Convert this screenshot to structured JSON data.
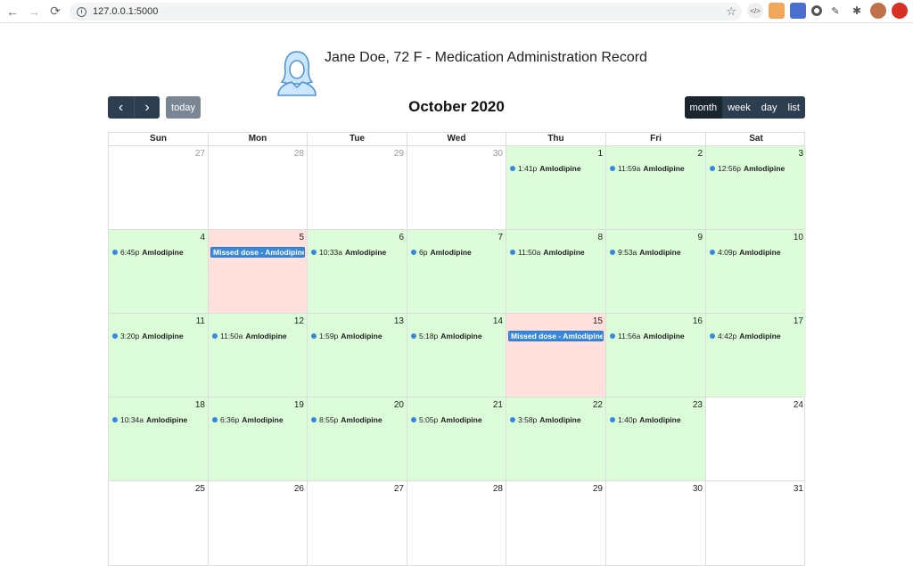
{
  "browser": {
    "url": "127.0.0.1:5000"
  },
  "header": {
    "title": "Jane Doe, 72 F - Medication Administration Record"
  },
  "toolbar": {
    "prev_label": "‹",
    "next_label": "›",
    "today_label": "today",
    "month_title": "October 2020",
    "views": [
      "month",
      "week",
      "day",
      "list"
    ],
    "active_view": "month"
  },
  "calendar": {
    "days_of_week": [
      "Sun",
      "Mon",
      "Tue",
      "Wed",
      "Thu",
      "Fri",
      "Sat"
    ],
    "medication": "Amlodipine",
    "missed_label": "Missed dose - Amlodipine",
    "weeks": [
      [
        {
          "num": "27",
          "other": true,
          "status": "none"
        },
        {
          "num": "28",
          "other": true,
          "status": "none"
        },
        {
          "num": "29",
          "other": true,
          "status": "none"
        },
        {
          "num": "30",
          "other": true,
          "status": "none"
        },
        {
          "num": "1",
          "status": "taken",
          "time": "1:41p"
        },
        {
          "num": "2",
          "status": "taken",
          "time": "11:59a"
        },
        {
          "num": "3",
          "status": "taken",
          "time": "12:56p"
        }
      ],
      [
        {
          "num": "4",
          "status": "taken",
          "time": "6:45p"
        },
        {
          "num": "5",
          "status": "missed"
        },
        {
          "num": "6",
          "status": "taken",
          "time": "10:33a"
        },
        {
          "num": "7",
          "status": "taken",
          "time": "6p"
        },
        {
          "num": "8",
          "status": "taken",
          "time": "11:50a"
        },
        {
          "num": "9",
          "status": "taken",
          "time": "9:53a"
        },
        {
          "num": "10",
          "status": "taken",
          "time": "4:09p"
        }
      ],
      [
        {
          "num": "11",
          "status": "taken",
          "time": "3:20p"
        },
        {
          "num": "12",
          "status": "taken",
          "time": "11:50a"
        },
        {
          "num": "13",
          "status": "taken",
          "time": "1:59p"
        },
        {
          "num": "14",
          "status": "taken",
          "time": "5:18p"
        },
        {
          "num": "15",
          "status": "missed"
        },
        {
          "num": "16",
          "status": "taken",
          "time": "11:56a"
        },
        {
          "num": "17",
          "status": "taken",
          "time": "4:42p"
        }
      ],
      [
        {
          "num": "18",
          "status": "taken",
          "time": "10:34a"
        },
        {
          "num": "19",
          "status": "taken",
          "time": "6:36p"
        },
        {
          "num": "20",
          "status": "taken",
          "time": "8:55p"
        },
        {
          "num": "21",
          "status": "taken",
          "time": "5:05p"
        },
        {
          "num": "22",
          "status": "taken",
          "time": "3:58p"
        },
        {
          "num": "23",
          "status": "taken",
          "time": "1:40p"
        },
        {
          "num": "24",
          "status": "none"
        }
      ],
      [
        {
          "num": "25",
          "status": "none"
        },
        {
          "num": "26",
          "status": "none"
        },
        {
          "num": "27",
          "status": "none"
        },
        {
          "num": "28",
          "status": "none"
        },
        {
          "num": "29",
          "status": "none"
        },
        {
          "num": "30",
          "status": "none"
        },
        {
          "num": "31",
          "status": "none"
        }
      ]
    ]
  },
  "colors": {
    "taken_bg": "#dcfcd9",
    "missed_bg": "#ffe0dc",
    "event_blue": "#3788d8",
    "button_dark": "#2c3e50"
  }
}
